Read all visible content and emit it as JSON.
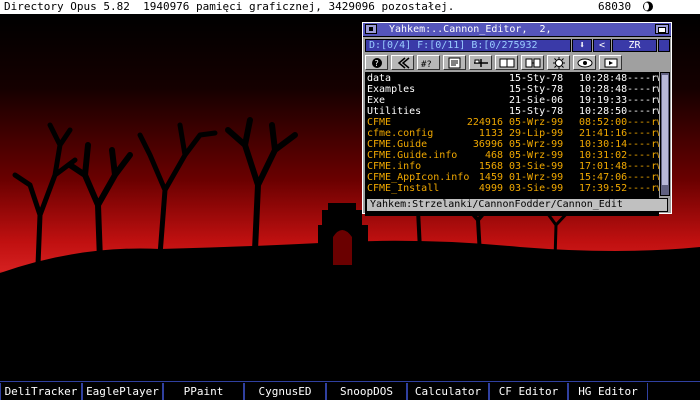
{
  "screen": {
    "title": "Directory Opus 5.82  1940976 pamięci graficznej, 3429096 pozostałej.",
    "counter": "68030"
  },
  "opus": {
    "title": "Yahkem:..Cannon_Editor,  2,",
    "status": "D:[0/4] F:[0/11] B:[0/275932",
    "zr_label": "ZR",
    "path": "Yahkem:Strzelanki/CannonFodder/Cannon_Edit",
    "toolbar_icons": [
      "help-icon",
      "parent-icon",
      "match-icon",
      "info-icon",
      "tree-icon",
      "copy-icon",
      "move-icon",
      "settings-icon",
      "view-icon",
      "run-icon"
    ],
    "files": [
      {
        "name": "data",
        "size": "",
        "date": "15-Sty-78",
        "time": "10:28:48",
        "attr": "----rwe",
        "type": "dir"
      },
      {
        "name": "Examples",
        "size": "",
        "date": "15-Sty-78",
        "time": "10:28:48",
        "attr": "----rwe",
        "type": "dir"
      },
      {
        "name": "Exe",
        "size": "",
        "date": "21-Sie-06",
        "time": "19:19:33",
        "attr": "----rwe",
        "type": "dir"
      },
      {
        "name": "Utilities",
        "size": "",
        "date": "15-Sty-78",
        "time": "10:28:50",
        "attr": "----rwe",
        "type": "dir"
      },
      {
        "name": "CFME",
        "size": "224916",
        "date": "05-Wrz-99",
        "time": "08:52:00",
        "attr": "----rwe",
        "type": "file"
      },
      {
        "name": "cfme.config",
        "size": "1133",
        "date": "29-Lip-99",
        "time": "21:41:16",
        "attr": "----rwe",
        "type": "file"
      },
      {
        "name": "CFME.Guide",
        "size": "36996",
        "date": "05-Wrz-99",
        "time": "10:30:14",
        "attr": "----rw-",
        "type": "file"
      },
      {
        "name": "CFME.Guide.info",
        "size": "468",
        "date": "05-Wrz-99",
        "time": "10:31:02",
        "attr": "----rw-",
        "type": "file"
      },
      {
        "name": "CFME.info",
        "size": "1568",
        "date": "03-Sie-99",
        "time": "17:01:48",
        "attr": "----rw-",
        "type": "file"
      },
      {
        "name": "CFME_AppIcon.info",
        "size": "1459",
        "date": "01-Wrz-99",
        "time": "15:47:06",
        "attr": "----rw-",
        "type": "file"
      },
      {
        "name": "CFME_Install",
        "size": "4999",
        "date": "03-Sie-99",
        "time": "17:39:52",
        "attr": "----rwe",
        "type": "file"
      }
    ]
  },
  "bank": [
    "DeliTracker",
    "EaglePlayer",
    "PPaint",
    "CygnusED",
    "SnoopDOS",
    "Calculator",
    "CF Editor",
    "HG Editor"
  ],
  "colors": {
    "sky_top": "#000000",
    "sky_red": "#c01010",
    "opus_title": "#5555bb",
    "dir_text": "#ffffff",
    "file_text": "#f0a800"
  }
}
